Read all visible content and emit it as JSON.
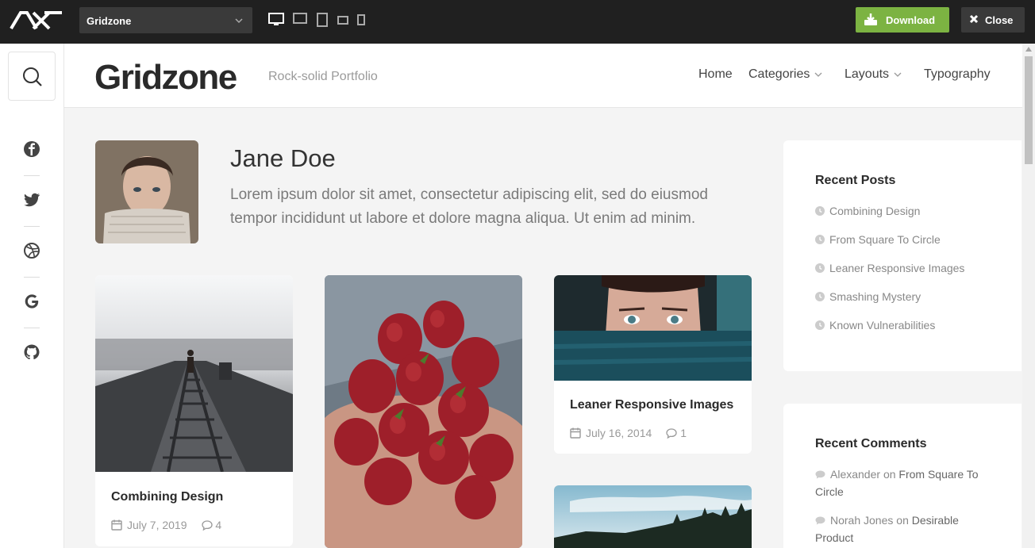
{
  "topbar": {
    "theme_name": "Gridzone",
    "devices": [
      "desktop-icon",
      "laptop-icon",
      "tablet-icon",
      "tablet-landscape-icon",
      "phone-icon"
    ],
    "download_label": "Download",
    "close_label": "Close",
    "download_color": "#7cb342"
  },
  "sidebar": {
    "social": [
      "facebook-icon",
      "twitter-icon",
      "dribbble-icon",
      "google-icon",
      "github-icon"
    ]
  },
  "header": {
    "site_title": "Gridzone",
    "tagline": "Rock-solid Portfolio",
    "nav": [
      {
        "label": "Home"
      },
      {
        "label": "Categories"
      },
      {
        "label": "Layouts"
      },
      {
        "label": "Typography"
      }
    ]
  },
  "author": {
    "name": "Jane Doe",
    "bio": "Lorem ipsum dolor sit amet, consectetur adipiscing elit, sed do eiusmod tempor incididunt ut labore et dolore magna aliqua. Ut enim ad minim."
  },
  "posts": [
    {
      "title": "Combining Design",
      "date": "July 7, 2019",
      "comments": "4"
    },
    {
      "title": "Leaner Responsive Images",
      "date": "July 16, 2014",
      "comments": "1"
    }
  ],
  "recent_posts": {
    "title": "Recent Posts",
    "items": [
      "Combining Design",
      "From Square To Circle",
      "Leaner Responsive Images",
      "Smashing Mystery",
      "Known Vulnerabilities"
    ]
  },
  "recent_comments": {
    "title": "Recent Comments",
    "items": [
      {
        "author": "Alexander",
        "on": "on",
        "post": "From Square To Circle"
      },
      {
        "author": "Norah Jones",
        "on": "on",
        "post": "Desirable Product"
      }
    ]
  }
}
